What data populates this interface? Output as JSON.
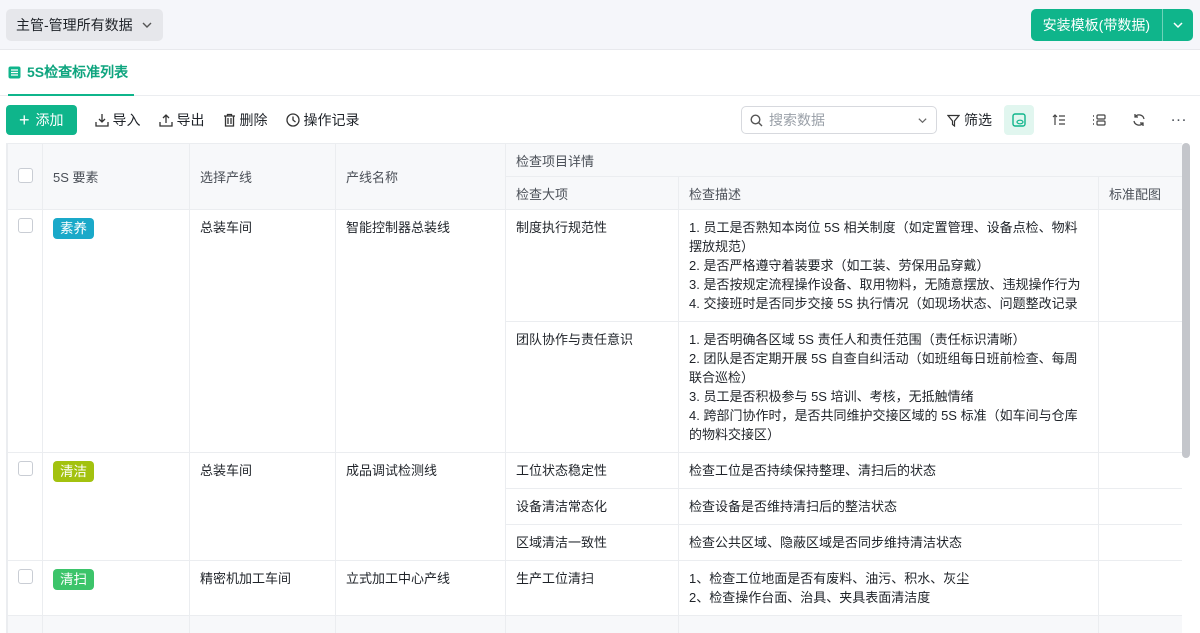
{
  "header": {
    "role_selector": "主管-管理所有数据",
    "install_button": "安装模板(带数据)"
  },
  "tab": {
    "label": "5S检查标准列表"
  },
  "toolbar": {
    "add": "添加",
    "import": "导入",
    "export": "导出",
    "delete": "删除",
    "log": "操作记录",
    "search_placeholder": "搜索数据",
    "filter": "筛选"
  },
  "table": {
    "headers": {
      "element": "5S 要素",
      "line_select": "选择产线",
      "line_name": "产线名称",
      "group": "检查项目详情",
      "item": "检查大项",
      "desc": "检查描述",
      "image": "标准配图"
    },
    "rows": [
      {
        "tag": "素养",
        "tag_color": "#1aa9c9",
        "line_select": "总装车间",
        "line_name": "智能控制器总装线",
        "items": [
          {
            "item": "制度执行规范性",
            "desc": [
              "1. 员工是否熟知本岗位 5S 相关制度（如定置管理、设备点检、物料摆放规范）",
              "2. 是否严格遵守着装要求（如工装、劳保用品穿戴）",
              "3. 是否按规定流程操作设备、取用物料，无随意摆放、违规操作行为",
              "4. 交接班时是否同步交接 5S 执行情况（如现场状态、问题整改记录"
            ]
          },
          {
            "item": "团队协作与责任意识",
            "desc": [
              "1. 是否明确各区域 5S 责任人和责任范围（责任标识清晰）",
              "2. 团队是否定期开展 5S 自查自纠活动（如班组每日班前检查、每周联合巡检）",
              "3. 员工是否积极参与 5S 培训、考核，无抵触情绪",
              "4. 跨部门协作时，是否共同维护交接区域的 5S 标准（如车间与仓库的物料交接区）"
            ]
          }
        ]
      },
      {
        "tag": "清洁",
        "tag_color": "#a3c20f",
        "line_select": "总装车间",
        "line_name": "成品调试检测线",
        "items": [
          {
            "item": "工位状态稳定性",
            "desc": [
              "检查工位是否持续保持整理、清扫后的状态"
            ]
          },
          {
            "item": "设备清洁常态化",
            "desc": [
              "检查设备是否维持清扫后的整洁状态"
            ]
          },
          {
            "item": "区域清洁一致性",
            "desc": [
              "检查公共区域、隐蔽区域是否同步维持清洁状态"
            ]
          }
        ]
      },
      {
        "tag": "清扫",
        "tag_color": "#3cc46a",
        "line_select": "精密机加工车间",
        "line_name": "立式加工中心产线",
        "items": [
          {
            "item": "生产工位清扫",
            "desc": [
              "1、检查工位地面是否有废料、油污、积水、灰尘",
              "2、检查操作台面、治具、夹具表面清洁度"
            ]
          }
        ]
      }
    ]
  }
}
